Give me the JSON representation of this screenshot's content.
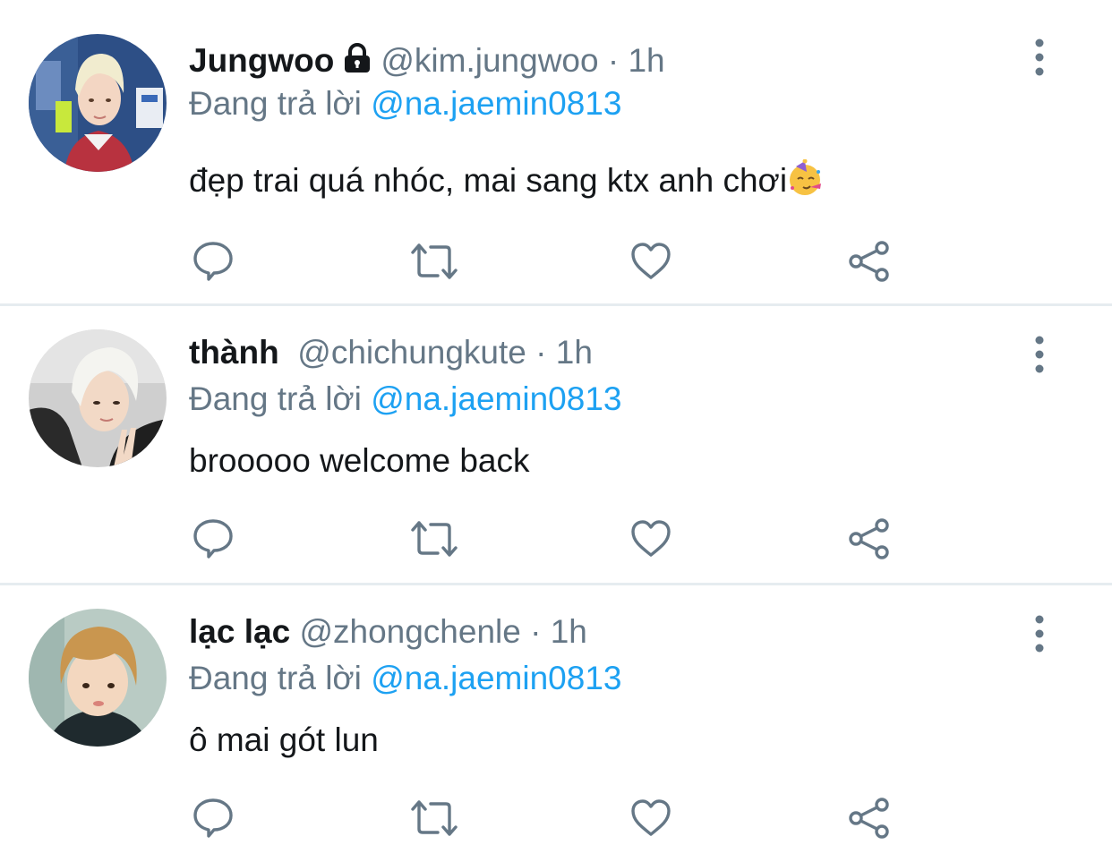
{
  "colors": {
    "text": "#14171a",
    "secondary": "#657786",
    "link": "#1da1f2",
    "divider": "#e6ecf0",
    "icon": "#657786"
  },
  "tweets": [
    {
      "name": "Jungwoo",
      "protected": true,
      "handle": "@kim.jungwoo",
      "dot": "·",
      "time": "1h",
      "reply_prefix": "Đang trả lời ",
      "reply_to": "@na.jaemin0813",
      "text": "đẹp trai quá nhóc, mai sang ktx anh chơi",
      "emoji": "partying-face",
      "avatar": "avatar-blond-plaid-shirt"
    },
    {
      "name": "thành",
      "protected": false,
      "handle": "@chichungkute",
      "dot": "·",
      "time": "1h",
      "reply_prefix": "Đang trả lời ",
      "reply_to": "@na.jaemin0813",
      "text": "brooooo welcome back",
      "avatar": "avatar-white-hair-peace-sign"
    },
    {
      "name": "lạc lạc",
      "protected": false,
      "handle": "@zhongchenle",
      "dot": "·",
      "time": "1h",
      "reply_prefix": "Đang trả lời ",
      "reply_to": "@na.jaemin0813",
      "text": "ô mai gót lun",
      "avatar": "avatar-brown-hair-selfie"
    }
  ],
  "actions": [
    "reply-icon",
    "retweet-icon",
    "like-icon",
    "share-icon"
  ]
}
